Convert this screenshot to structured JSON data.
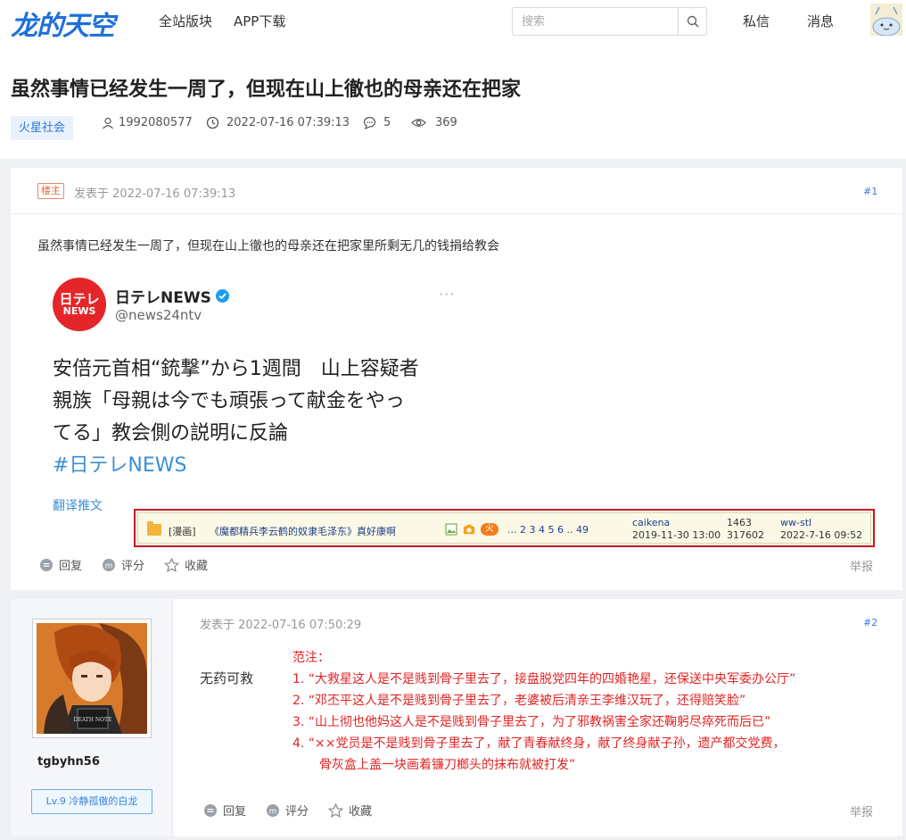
{
  "header": {
    "logo": "龙的天空",
    "nav": [
      "全站版块",
      "APP下载"
    ],
    "search_placeholder": "搜索",
    "links": [
      "私信",
      "消息"
    ]
  },
  "thread": {
    "title": "虽然事情已经发生一周了，但现在山上徹也的母亲还在把家",
    "tag": "火星社会",
    "author": "1992080577",
    "time": "2022-07-16 07:39:13",
    "replies": "5",
    "views": "369"
  },
  "post1": {
    "badge": "楼主",
    "posted_at": "发表于 2022-07-16 07:39:13",
    "floor": "#1",
    "text": "虽然事情已经发生一周了，但现在山上徹也的母亲还在把家里所剩无几的钱捐给教会",
    "tweet": {
      "logo_line1": "日テレ",
      "logo_line2": "NEWS",
      "name": "日テレNEWS",
      "handle": "@news24ntv",
      "more": "···",
      "lines": [
        "安倍元首相“銃撃”から1週間　山上容疑者",
        "親族「母親は今でも頑張って献金をやっ",
        "てる」教会側の説明に反論"
      ],
      "hashtag": "#日テレNEWS",
      "translate": "翻译推文"
    }
  },
  "ad": {
    "category": "[漫画]",
    "title": "《魔都精兵李云鹤的奴隶毛泽东》真好康啊",
    "hot": "火",
    "pages": "... 2  3  4  5  6 .. 49",
    "author": "caikena",
    "author_date": "2019-11-30 13:00",
    "count1": "1463",
    "count2": "317602",
    "last_user": "ww-stl",
    "last_date": "2022-7-16 09:52"
  },
  "actions": {
    "reply": "回复",
    "rate": "评分",
    "favorite": "收藏",
    "report": "举报"
  },
  "post2": {
    "username": "tgbyhn56",
    "level": "Lv.9 冷静孤傲的白龙",
    "posted_at": "发表于 2022-07-16 07:50:29",
    "floor": "#2",
    "text": "无药可救",
    "quote_title": "范注：",
    "quote_lines": [
      "1.  “大救星这人是不是贱到骨子里去了，接盘脱党四年的四婚艳星，还保送中央军委办公厅”",
      "2.  “邓丕平这人是不是贱到骨子里去了，老婆被后清亲王李维汉玩了，还得赔笑脸”",
      "3.  “山上彻也他妈这人是不是贱到骨子里去了，为了邪教祸害全家还鞠躬尽瘁死而后已”",
      "4.  “××党员是不是贱到骨子里去了，献了青春献终身，献了终身献子孙，遗产都交党费，"
    ],
    "quote_cont": "骨灰盒上盖一块画着镰刀榔头的抹布就被打发”"
  }
}
